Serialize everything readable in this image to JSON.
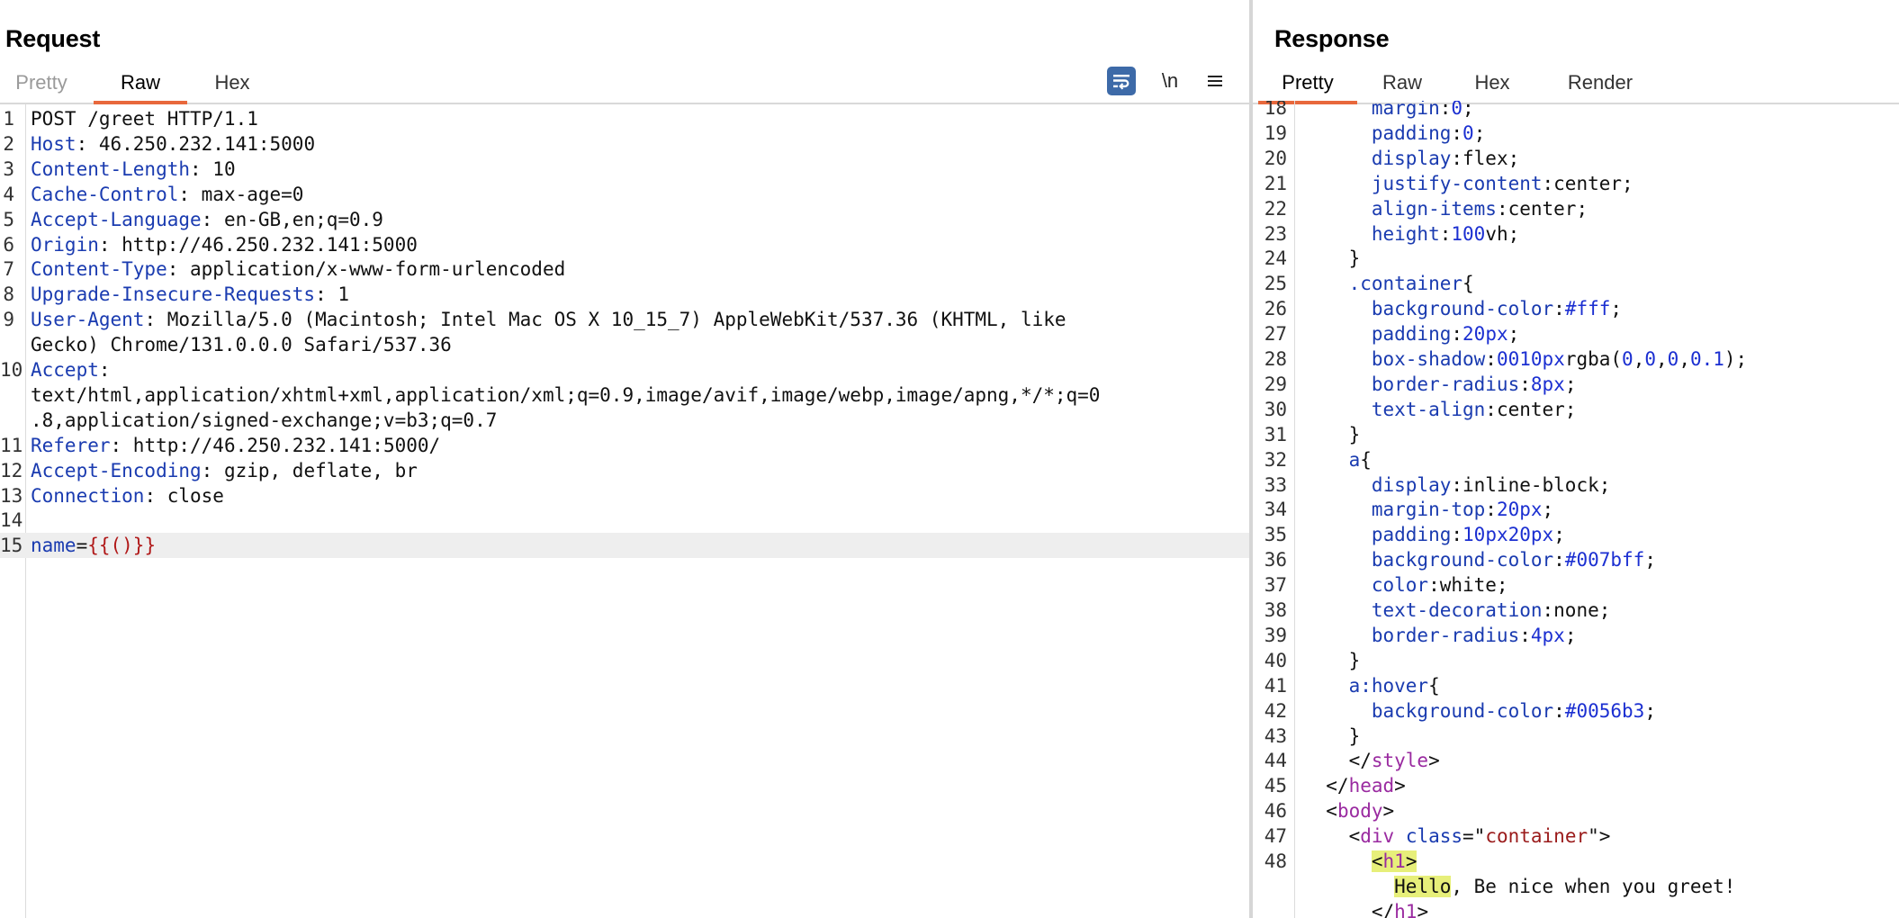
{
  "request": {
    "title": "Request",
    "tabs": [
      "Pretty",
      "Raw",
      "Hex"
    ],
    "active_tab": "Raw",
    "toolbar": {
      "wrap_icon": "wrap-text-icon",
      "newline_label": "\\n",
      "menu_icon": "hamburger-menu-icon"
    },
    "lines": [
      {
        "n": "1",
        "parts": [
          [
            "v",
            "POST /greet HTTP/1.1"
          ]
        ]
      },
      {
        "n": "2",
        "parts": [
          [
            "k",
            "Host"
          ],
          [
            "v",
            ": 46.250.232.141:5000"
          ]
        ]
      },
      {
        "n": "3",
        "parts": [
          [
            "k",
            "Content-Length"
          ],
          [
            "v",
            ": 10"
          ]
        ]
      },
      {
        "n": "4",
        "parts": [
          [
            "k",
            "Cache-Control"
          ],
          [
            "v",
            ": max-age=0"
          ]
        ]
      },
      {
        "n": "5",
        "parts": [
          [
            "k",
            "Accept-Language"
          ],
          [
            "v",
            ": en-GB,en;q=0.9"
          ]
        ]
      },
      {
        "n": "6",
        "parts": [
          [
            "k",
            "Origin"
          ],
          [
            "v",
            ": http://46.250.232.141:5000"
          ]
        ]
      },
      {
        "n": "7",
        "parts": [
          [
            "k",
            "Content-Type"
          ],
          [
            "v",
            ": application/x-www-form-urlencoded"
          ]
        ]
      },
      {
        "n": "8",
        "parts": [
          [
            "k",
            "Upgrade-Insecure-Requests"
          ],
          [
            "v",
            ": 1"
          ]
        ]
      },
      {
        "n": "9",
        "parts": [
          [
            "k",
            "User-Agent"
          ],
          [
            "v",
            ": Mozilla/5.0 (Macintosh; Intel Mac OS X 10_15_7) AppleWebKit/537.36 (KHTML, like"
          ]
        ]
      },
      {
        "n": "",
        "parts": [
          [
            "v",
            "Gecko) Chrome/131.0.0.0 Safari/537.36"
          ]
        ]
      },
      {
        "n": "10",
        "parts": [
          [
            "k",
            "Accept"
          ],
          [
            "v",
            ":"
          ]
        ]
      },
      {
        "n": "",
        "parts": [
          [
            "v",
            "text/html,application/xhtml+xml,application/xml;q=0.9,image/avif,image/webp,image/apng,*/*;q=0"
          ]
        ]
      },
      {
        "n": "",
        "parts": [
          [
            "v",
            ".8,application/signed-exchange;v=b3;q=0.7"
          ]
        ]
      },
      {
        "n": "11",
        "parts": [
          [
            "k",
            "Referer"
          ],
          [
            "v",
            ": http://46.250.232.141:5000/"
          ]
        ]
      },
      {
        "n": "12",
        "parts": [
          [
            "k",
            "Accept-Encoding"
          ],
          [
            "v",
            ": gzip, deflate, br"
          ]
        ]
      },
      {
        "n": "13",
        "parts": [
          [
            "k",
            "Connection"
          ],
          [
            "v",
            ": close"
          ]
        ]
      },
      {
        "n": "14",
        "parts": []
      },
      {
        "n": "15",
        "highlight": true,
        "parts": [
          [
            "k",
            "name"
          ],
          [
            "v",
            "="
          ],
          [
            "red",
            "{{()}}"
          ]
        ]
      }
    ]
  },
  "response": {
    "title": "Response",
    "tabs": [
      "Pretty",
      "Raw",
      "Hex",
      "Render"
    ],
    "active_tab": "Pretty",
    "lines": [
      {
        "n": "18",
        "parts": [
          [
            "v",
            "      "
          ],
          [
            "k",
            "margin"
          ],
          [
            "v",
            ":"
          ],
          [
            "numv",
            "0"
          ],
          [
            "v",
            ";"
          ]
        ]
      },
      {
        "n": "19",
        "parts": [
          [
            "v",
            "      "
          ],
          [
            "k",
            "padding"
          ],
          [
            "v",
            ":"
          ],
          [
            "numv",
            "0"
          ],
          [
            "v",
            ";"
          ]
        ]
      },
      {
        "n": "20",
        "parts": [
          [
            "v",
            "      "
          ],
          [
            "k",
            "display"
          ],
          [
            "v",
            ":flex;"
          ]
        ]
      },
      {
        "n": "21",
        "parts": [
          [
            "v",
            "      "
          ],
          [
            "k",
            "justify-content"
          ],
          [
            "v",
            ":center;"
          ]
        ]
      },
      {
        "n": "22",
        "parts": [
          [
            "v",
            "      "
          ],
          [
            "k",
            "align-items"
          ],
          [
            "v",
            ":center;"
          ]
        ]
      },
      {
        "n": "23",
        "parts": [
          [
            "v",
            "      "
          ],
          [
            "k",
            "height"
          ],
          [
            "v",
            ":"
          ],
          [
            "numv",
            "100"
          ],
          [
            "v",
            "vh;"
          ]
        ]
      },
      {
        "n": "24",
        "parts": [
          [
            "v",
            "    }"
          ]
        ]
      },
      {
        "n": "25",
        "parts": [
          [
            "v",
            "    "
          ],
          [
            "k",
            ".container"
          ],
          [
            "v",
            "{"
          ]
        ]
      },
      {
        "n": "26",
        "parts": [
          [
            "v",
            "      "
          ],
          [
            "k",
            "background-color"
          ],
          [
            "v",
            ":"
          ],
          [
            "numv",
            "#fff"
          ],
          [
            "v",
            ";"
          ]
        ]
      },
      {
        "n": "27",
        "parts": [
          [
            "v",
            "      "
          ],
          [
            "k",
            "padding"
          ],
          [
            "v",
            ":"
          ],
          [
            "numv",
            "20px"
          ],
          [
            "v",
            ";"
          ]
        ]
      },
      {
        "n": "28",
        "parts": [
          [
            "v",
            "      "
          ],
          [
            "k",
            "box-shadow"
          ],
          [
            "v",
            ":"
          ],
          [
            "numv",
            "0010px"
          ],
          [
            "v",
            "rgba("
          ],
          [
            "numv",
            "0"
          ],
          [
            "v",
            ","
          ],
          [
            "numv",
            "0"
          ],
          [
            "v",
            ","
          ],
          [
            "numv",
            "0"
          ],
          [
            "v",
            ","
          ],
          [
            "numv",
            "0.1"
          ],
          [
            "v",
            ");"
          ]
        ]
      },
      {
        "n": "29",
        "parts": [
          [
            "v",
            "      "
          ],
          [
            "k",
            "border-radius"
          ],
          [
            "v",
            ":"
          ],
          [
            "numv",
            "8px"
          ],
          [
            "v",
            ";"
          ]
        ]
      },
      {
        "n": "30",
        "parts": [
          [
            "v",
            "      "
          ],
          [
            "k",
            "text-align"
          ],
          [
            "v",
            ":center;"
          ]
        ]
      },
      {
        "n": "31",
        "parts": [
          [
            "v",
            "    }"
          ]
        ]
      },
      {
        "n": "32",
        "parts": [
          [
            "v",
            "    "
          ],
          [
            "k",
            "a"
          ],
          [
            "v",
            "{"
          ]
        ]
      },
      {
        "n": "33",
        "parts": [
          [
            "v",
            "      "
          ],
          [
            "k",
            "display"
          ],
          [
            "v",
            ":inline-block;"
          ]
        ]
      },
      {
        "n": "34",
        "parts": [
          [
            "v",
            "      "
          ],
          [
            "k",
            "margin-top"
          ],
          [
            "v",
            ":"
          ],
          [
            "numv",
            "20px"
          ],
          [
            "v",
            ";"
          ]
        ]
      },
      {
        "n": "35",
        "parts": [
          [
            "v",
            "      "
          ],
          [
            "k",
            "padding"
          ],
          [
            "v",
            ":"
          ],
          [
            "numv",
            "10px20px"
          ],
          [
            "v",
            ";"
          ]
        ]
      },
      {
        "n": "36",
        "parts": [
          [
            "v",
            "      "
          ],
          [
            "k",
            "background-color"
          ],
          [
            "v",
            ":"
          ],
          [
            "numv",
            "#007bff"
          ],
          [
            "v",
            ";"
          ]
        ]
      },
      {
        "n": "37",
        "parts": [
          [
            "v",
            "      "
          ],
          [
            "k",
            "color"
          ],
          [
            "v",
            ":white;"
          ]
        ]
      },
      {
        "n": "38",
        "parts": [
          [
            "v",
            "      "
          ],
          [
            "k",
            "text-decoration"
          ],
          [
            "v",
            ":none;"
          ]
        ]
      },
      {
        "n": "39",
        "parts": [
          [
            "v",
            "      "
          ],
          [
            "k",
            "border-radius"
          ],
          [
            "v",
            ":"
          ],
          [
            "numv",
            "4px"
          ],
          [
            "v",
            ";"
          ]
        ]
      },
      {
        "n": "40",
        "parts": [
          [
            "v",
            "    }"
          ]
        ]
      },
      {
        "n": "41",
        "parts": [
          [
            "v",
            "    "
          ],
          [
            "k",
            "a:hover"
          ],
          [
            "v",
            "{"
          ]
        ]
      },
      {
        "n": "42",
        "parts": [
          [
            "v",
            "      "
          ],
          [
            "k",
            "background-color"
          ],
          [
            "v",
            ":"
          ],
          [
            "numv",
            "#0056b3"
          ],
          [
            "v",
            ";"
          ]
        ]
      },
      {
        "n": "43",
        "parts": [
          [
            "v",
            "    }"
          ]
        ]
      },
      {
        "n": "44",
        "parts": [
          [
            "v",
            "    </"
          ],
          [
            "tag",
            "style"
          ],
          [
            "v",
            ">"
          ]
        ]
      },
      {
        "n": "45",
        "parts": [
          [
            "v",
            "  </"
          ],
          [
            "tag",
            "head"
          ],
          [
            "v",
            ">"
          ]
        ]
      },
      {
        "n": "46",
        "parts": [
          [
            "v",
            "  <"
          ],
          [
            "tag",
            "body"
          ],
          [
            "v",
            ">"
          ]
        ]
      },
      {
        "n": "47",
        "parts": [
          [
            "v",
            "    <"
          ],
          [
            "tag",
            "div"
          ],
          [
            "v",
            " "
          ],
          [
            "attr",
            "class"
          ],
          [
            "v",
            "=\""
          ],
          [
            "str",
            "container"
          ],
          [
            "v",
            "\">"
          ]
        ]
      },
      {
        "n": "48",
        "parts": [
          [
            "v",
            "      "
          ],
          [
            "hl",
            "<"
          ],
          [
            "hl tag",
            "h1"
          ],
          [
            "hl",
            ">"
          ]
        ]
      },
      {
        "n": "",
        "parts": [
          [
            "v",
            "        "
          ],
          [
            "hl",
            "Hello"
          ],
          [
            "v",
            ", Be nice when you greet!"
          ]
        ]
      },
      {
        "n": "",
        "parts": [
          [
            "v",
            "      </"
          ],
          [
            "tag",
            "h1"
          ],
          [
            "v",
            ">"
          ]
        ]
      }
    ]
  }
}
